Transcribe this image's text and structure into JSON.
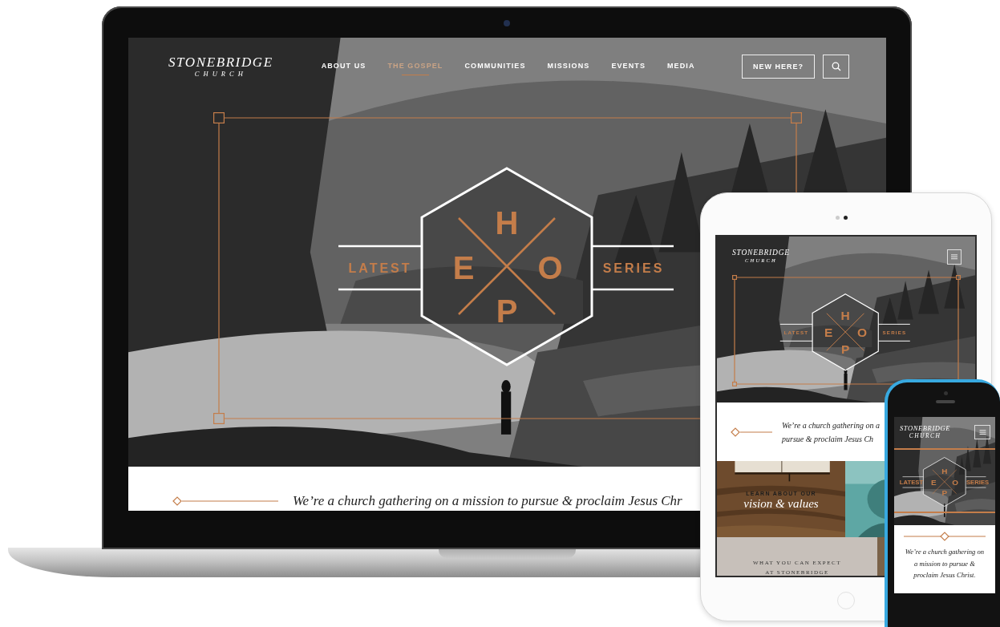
{
  "laptop": {
    "logo": {
      "name": "STONEBRIDGE",
      "sub": "CHURCH"
    },
    "nav": [
      {
        "label": "ABOUT US",
        "selected": false
      },
      {
        "label": "THE GOSPEL",
        "selected": true
      },
      {
        "label": "COMMUNITIES",
        "selected": false
      },
      {
        "label": "MISSIONS",
        "selected": false
      },
      {
        "label": "EVENTS",
        "selected": false
      },
      {
        "label": "MEDIA",
        "selected": false
      }
    ],
    "new_here_button": "NEW HERE?",
    "emblem": {
      "left": "LATEST",
      "right": "SERIES",
      "letters": [
        "H",
        "E",
        "O",
        "P"
      ]
    },
    "tagline": "We’re a church gathering on a mission to pursue & proclaim Jesus Chr"
  },
  "tablet": {
    "logo": {
      "name": "STONEBRIDGE",
      "sub": "CHURCH"
    },
    "emblem": {
      "left": "LATEST",
      "right": "SERIES",
      "letters": [
        "H",
        "E",
        "O",
        "P"
      ]
    },
    "tagline_lines": [
      "We’re a church gathering on a",
      "pursue & proclaim Jesus Ch"
    ],
    "tile": {
      "kicker": "LEARN ABOUT OUR",
      "title": "vision & values"
    },
    "expect_lines": [
      "WHAT YOU CAN EXPECT",
      "AT STONEBRIDGE"
    ]
  },
  "phone": {
    "logo": {
      "name": "STONEBRIDGE",
      "sub": "CHURCH"
    },
    "emblem": {
      "left": "LATEST",
      "right": "SERIES",
      "letters": [
        "H",
        "E",
        "O",
        "P"
      ]
    },
    "tagline": "We’re a church gathering on a mission to pursue & proclaim Jesus Christ."
  }
}
